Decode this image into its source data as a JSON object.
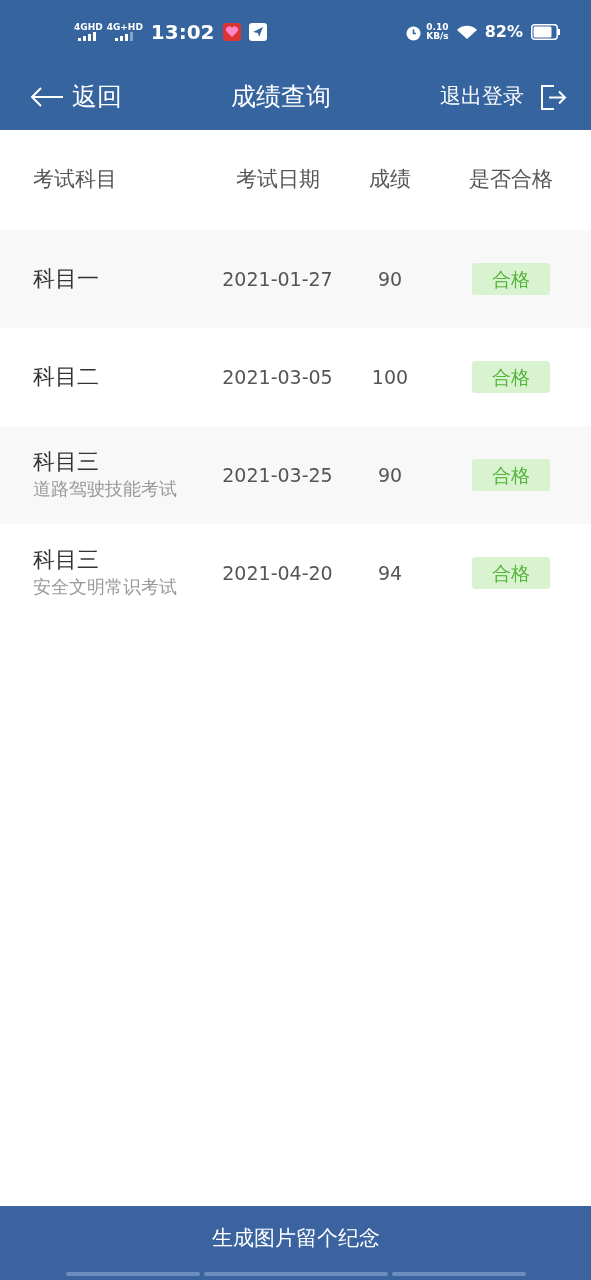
{
  "status_bar": {
    "network_1": "4GHD",
    "network_2": "4G+HD",
    "time": "13:02",
    "speed": "0.10",
    "speed_unit": "KB/s",
    "battery": "82%"
  },
  "header": {
    "back": "返回",
    "title": "成绩查询",
    "logout": "退出登录"
  },
  "table": {
    "columns": [
      "考试科目",
      "考试日期",
      "成绩",
      "是否合格"
    ],
    "rows": [
      {
        "subject": "科目一",
        "date": "2021-01-27",
        "score": "90",
        "result": "合格",
        "passed": true
      },
      {
        "subject": "科目二",
        "date": "2021-03-05",
        "score": "100",
        "result": "合格",
        "passed": true
      },
      {
        "subject": "科目三",
        "note": "道路驾驶技能考试",
        "date": "2021-03-25",
        "score": "90",
        "result": "合格",
        "passed": true
      },
      {
        "subject": "科目三",
        "note": "安全文明常识考试",
        "date": "2021-04-20",
        "score": "94",
        "result": "合格",
        "passed": true
      }
    ]
  },
  "footer": {
    "button": "生成图片留个纪念"
  }
}
